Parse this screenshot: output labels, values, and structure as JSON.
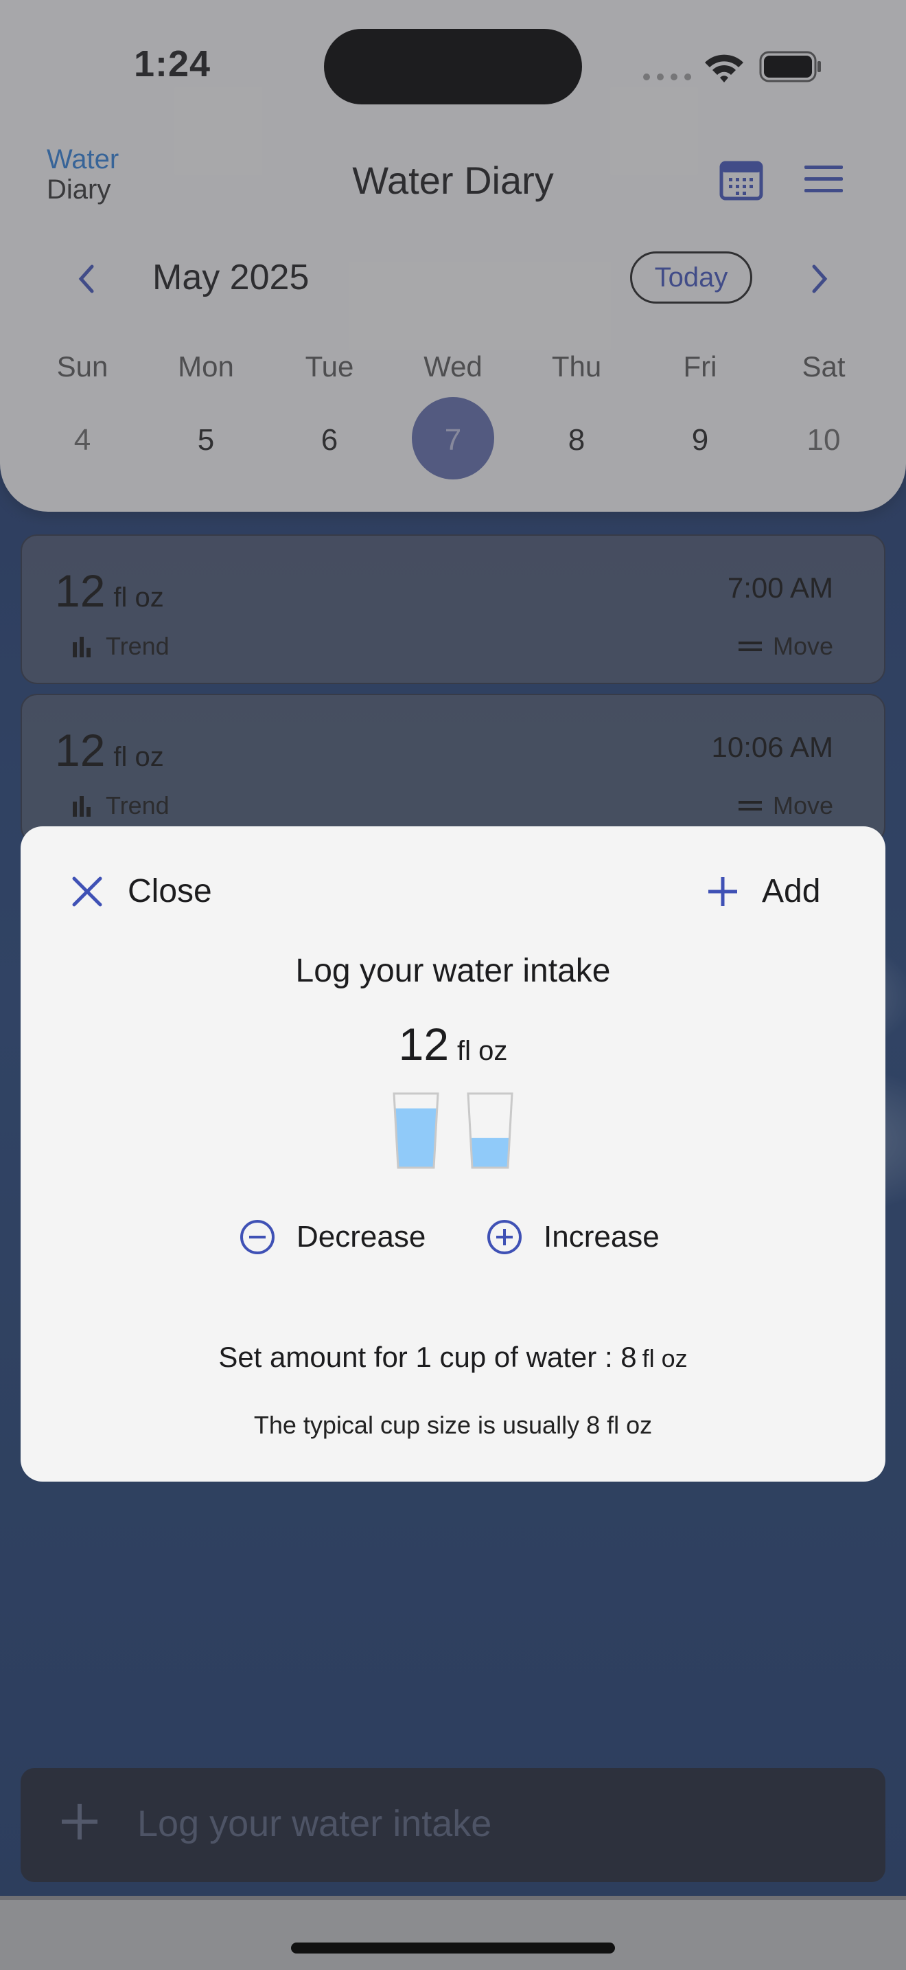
{
  "status_bar": {
    "time": "1:24"
  },
  "header": {
    "logo_line1": "Water",
    "logo_line2": "Diary",
    "title": "Water Diary",
    "month": "May 2025",
    "today_label": "Today"
  },
  "week": {
    "day_names": [
      "Sun",
      "Mon",
      "Tue",
      "Wed",
      "Thu",
      "Fri",
      "Sat"
    ],
    "day_numbers": [
      "4",
      "5",
      "6",
      "7",
      "8",
      "9",
      "10"
    ],
    "selected": "7"
  },
  "entries": [
    {
      "amount": "12",
      "unit": "fl oz",
      "time": "7:00 AM",
      "trend_label": "Trend",
      "move_label": "Move"
    },
    {
      "amount": "12",
      "unit": "fl oz",
      "time": "10:06 AM",
      "trend_label": "Trend",
      "move_label": "Move"
    }
  ],
  "modal": {
    "close_label": "Close",
    "add_label": "Add",
    "title": "Log your water intake",
    "amount": "12",
    "unit": "fl oz",
    "cups": [
      {
        "fill": 0.8
      },
      {
        "fill": 0.4
      }
    ],
    "decrease_label": "Decrease",
    "increase_label": "Increase",
    "set_amount_text": "Set amount for 1 cup of water : 8",
    "set_amount_unit": "fl oz",
    "hint": "The typical cup size is usually 8 fl oz"
  },
  "bottom": {
    "placeholder": "Log your water intake"
  },
  "colors": {
    "accent": "#3f51b5",
    "water": "#90caf9",
    "logo_blue": "#2d7bd1"
  }
}
